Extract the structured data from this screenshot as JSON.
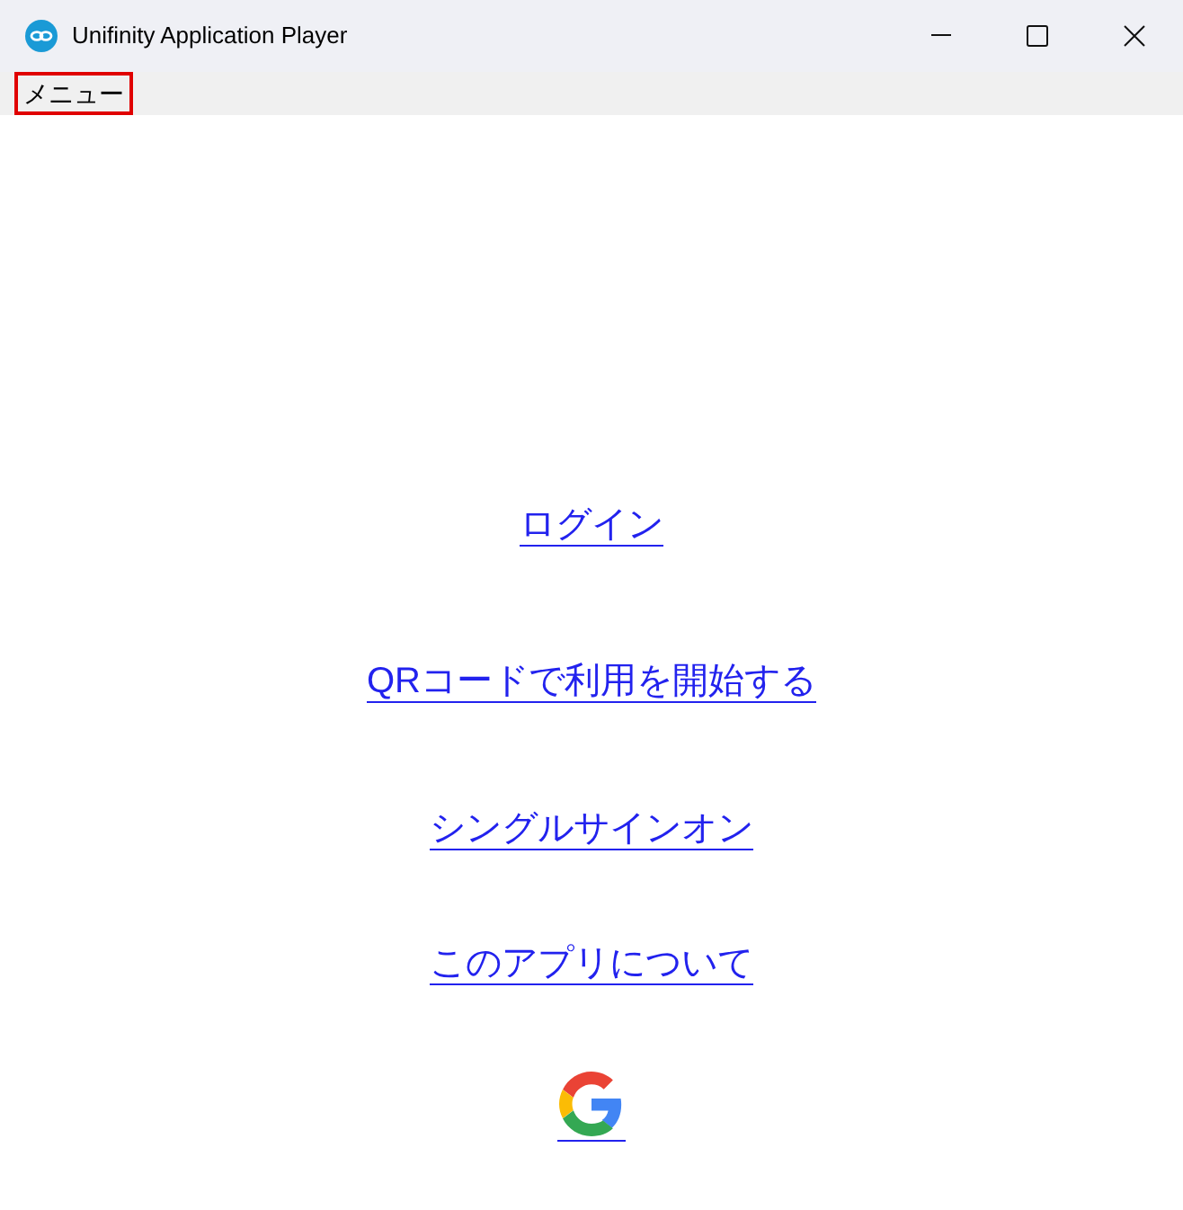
{
  "window": {
    "title": "Unifinity Application Player"
  },
  "menu_bar": [
    {
      "label": "メニュー",
      "highlighted": true
    }
  ],
  "links": [
    {
      "label": "ログイン"
    },
    {
      "label": "QRコードで利用を開始する"
    },
    {
      "label": "シングルサインオン"
    },
    {
      "label": "このアプリについて"
    }
  ]
}
